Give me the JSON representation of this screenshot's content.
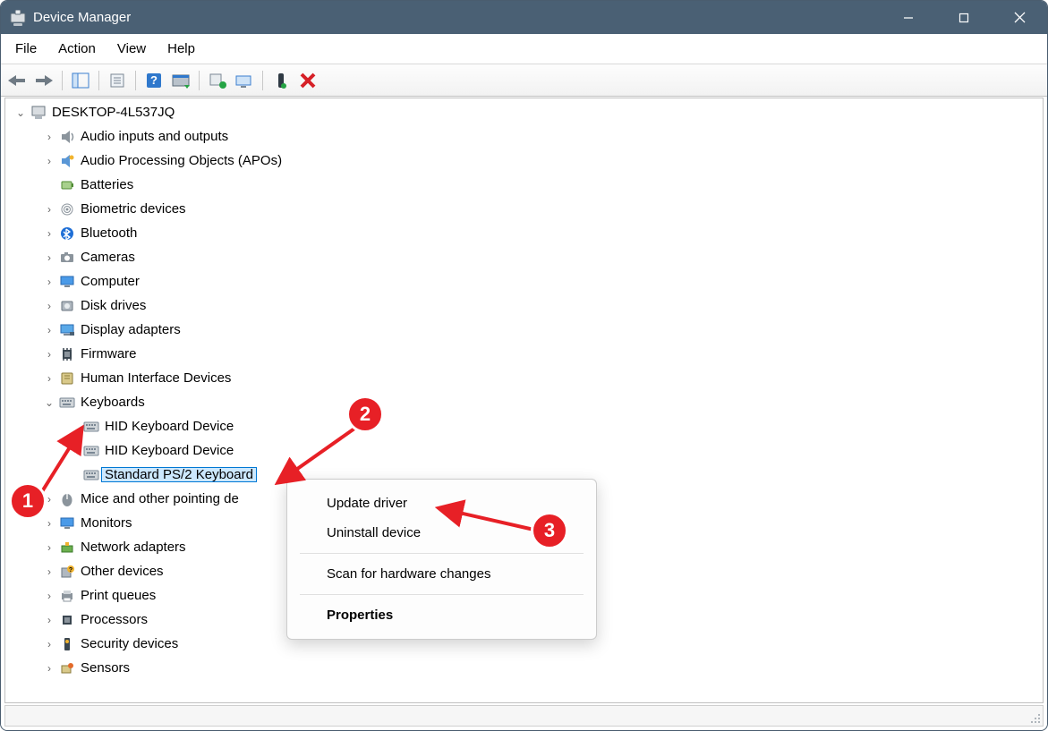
{
  "window": {
    "title": "Device Manager"
  },
  "menu": {
    "file": "File",
    "action": "Action",
    "view": "View",
    "help": "Help"
  },
  "tree": {
    "root": "DESKTOP-4L537JQ",
    "categories": [
      {
        "label": "Audio inputs and outputs",
        "icon": "speaker",
        "children": []
      },
      {
        "label": "Audio Processing Objects (APOs)",
        "icon": "apo",
        "children": []
      },
      {
        "label": "Batteries",
        "icon": "battery",
        "children": [],
        "no_caret": true
      },
      {
        "label": "Biometric devices",
        "icon": "fingerprint",
        "children": []
      },
      {
        "label": "Bluetooth",
        "icon": "bt",
        "children": []
      },
      {
        "label": "Cameras",
        "icon": "camera",
        "children": []
      },
      {
        "label": "Computer",
        "icon": "monitor",
        "children": []
      },
      {
        "label": "Disk drives",
        "icon": "disk",
        "children": []
      },
      {
        "label": "Display adapters",
        "icon": "display",
        "children": []
      },
      {
        "label": "Firmware",
        "icon": "chip",
        "children": []
      },
      {
        "label": "Human Interface Devices",
        "icon": "hid",
        "children": []
      },
      {
        "label": "Keyboards",
        "icon": "keyboard",
        "expanded": true,
        "children": [
          {
            "label": "HID Keyboard Device",
            "icon": "keyboard"
          },
          {
            "label": "HID Keyboard Device",
            "icon": "keyboard"
          },
          {
            "label": "Standard PS/2 Keyboard",
            "icon": "keyboard",
            "selected": true
          }
        ]
      },
      {
        "label": "Mice and other pointing devices",
        "icon": "mouse",
        "children": [],
        "truncated": "Mice and other pointing de"
      },
      {
        "label": "Monitors",
        "icon": "monitor2",
        "children": []
      },
      {
        "label": "Network adapters",
        "icon": "net",
        "children": []
      },
      {
        "label": "Other devices",
        "icon": "other",
        "children": []
      },
      {
        "label": "Print queues",
        "icon": "printer",
        "children": []
      },
      {
        "label": "Processors",
        "icon": "cpu",
        "children": []
      },
      {
        "label": "Security devices",
        "icon": "security",
        "children": []
      },
      {
        "label": "Sensors",
        "icon": "sensor",
        "children": []
      }
    ]
  },
  "context_menu": {
    "update": "Update driver",
    "uninstall": "Uninstall device",
    "scan": "Scan for hardware changes",
    "properties": "Properties"
  },
  "annotations": {
    "b1": "1",
    "b2": "2",
    "b3": "3"
  }
}
